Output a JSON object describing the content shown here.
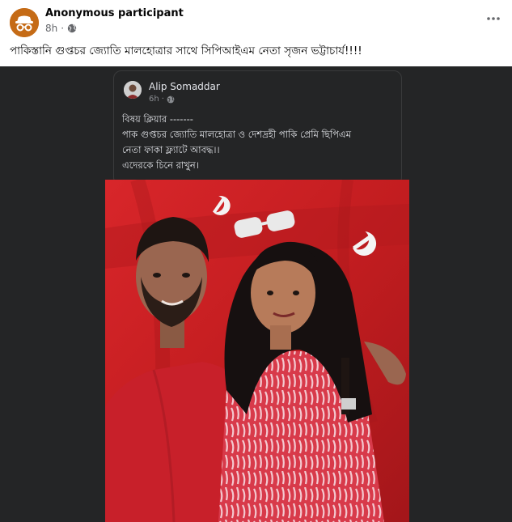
{
  "post": {
    "author": "Anonymous participant",
    "time": "8h",
    "privacy_icon": "globe-icon",
    "menu_icon": "more-options-icon",
    "caption": "পাকিস্তানি গুপ্তচর জ্যোতি মালহোত্রার সাথে সিপিআইএম নেতা সৃজন ভট্টাচার্য!!!!"
  },
  "shared_post": {
    "author": "Alip Somaddar",
    "time": "6h",
    "privacy_icon": "globe-icon",
    "lines": [
      "বিষয় ক্লিয়ার -------",
      "পাক গুপ্তচর জ্যোতি মালহোত্রা ও দেশদ্রহী পাকি প্রেমি ছিপিএম",
      "নেতা ফাকা ফ্ল্যাটে আবদ্ধ।।",
      "এদেরকে চিনে রাখুন।"
    ]
  },
  "colors": {
    "background": "#ffffff",
    "media_background": "#242526",
    "flag_red": "#c51f21",
    "avatar_orange": "#c56b16",
    "text_primary": "#050505",
    "text_secondary": "#65676b"
  }
}
